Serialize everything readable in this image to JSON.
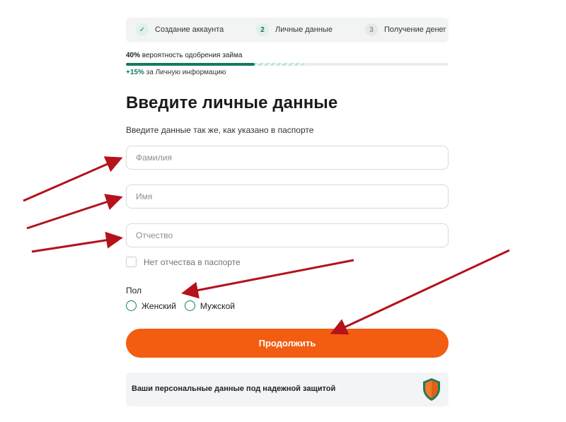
{
  "stepper": {
    "steps": [
      {
        "number": "",
        "label": "Создание аккаунта",
        "state": "done"
      },
      {
        "number": "2",
        "label": "Личные данные",
        "state": "active"
      },
      {
        "number": "3",
        "label": "Получение денег",
        "state": "next"
      }
    ]
  },
  "progress": {
    "percent_text": "40%",
    "caption": " вероятность одобрения займа",
    "value": 0.4,
    "bonus_value": 0.15,
    "bonus_percent": "+15%",
    "bonus_caption": " за Личную информацию"
  },
  "form": {
    "title": "Введите личные данные",
    "subtitle": "Введите данные так же, как указано в паспорте",
    "last_name": {
      "placeholder": "Фамилия",
      "value": ""
    },
    "first_name": {
      "placeholder": "Имя",
      "value": ""
    },
    "middle_name": {
      "placeholder": "Отчество",
      "value": ""
    },
    "no_middle_name_label": "Нет отчества в паспорте",
    "gender_label": "Пол",
    "gender_options": [
      "Женский",
      "Мужской"
    ],
    "submit_label": "Продолжить"
  },
  "security": {
    "text": "Ваши персональные данные под надежной защитой",
    "icon": "shield-icon"
  },
  "colors": {
    "accent": "#f25d12",
    "brand_green": "#147a63",
    "annotation_arrow": "#b5121b"
  }
}
